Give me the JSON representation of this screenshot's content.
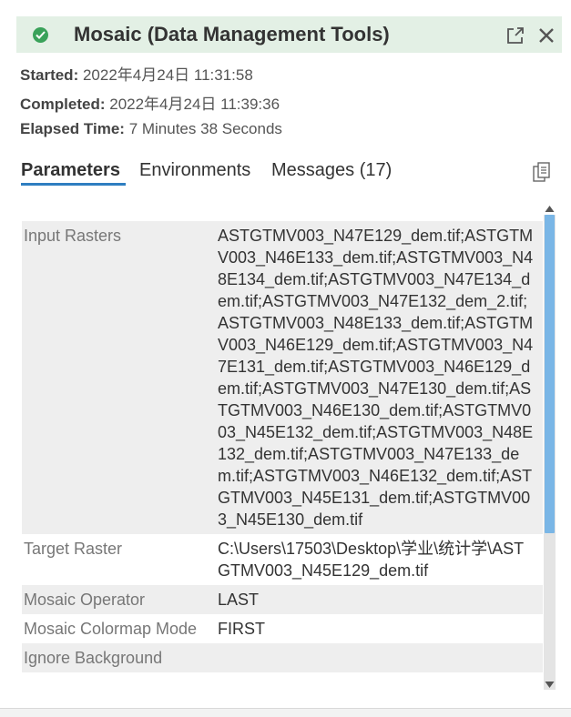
{
  "header": {
    "title": "Mosaic (Data Management Tools)",
    "status_icon": "check-circle-icon",
    "status_color": "#3aa25a",
    "background": "#e3f0e5"
  },
  "meta": {
    "started_label": "Started:",
    "started_value": "2022年4月24日 11:31:58",
    "completed_label": "Completed:",
    "completed_value": "2022年4月24日 11:39:36",
    "elapsed_label": "Elapsed Time:",
    "elapsed_value": "7 Minutes 38 Seconds"
  },
  "tabs": [
    {
      "label": "Parameters",
      "active": true
    },
    {
      "label": "Environments",
      "active": false
    },
    {
      "label": "Messages (17)",
      "active": false
    }
  ],
  "accent_color": "#2f7ec1",
  "parameters": [
    {
      "label": "Input Rasters",
      "value": "ASTGTMV003_N47E129_dem.tif;ASTGTMV003_N46E133_dem.tif;ASTGTMV003_N48E134_dem.tif;ASTGTMV003_N47E134_dem.tif;ASTGTMV003_N47E132_dem_2.tif;ASTGTMV003_N48E133_dem.tif;ASTGTMV003_N46E129_dem.tif;ASTGTMV003_N47E131_dem.tif;ASTGTMV003_N46E129_dem.tif;ASTGTMV003_N47E130_dem.tif;ASTGTMV003_N46E130_dem.tif;ASTGTMV003_N45E132_dem.tif;ASTGTMV003_N48E132_dem.tif;ASTGTMV003_N47E133_dem.tif;ASTGTMV003_N46E132_dem.tif;ASTGTMV003_N45E131_dem.tif;ASTGTMV003_N45E130_dem.tif"
    },
    {
      "label": "Target Raster",
      "value": "C:\\Users\\17503\\Desktop\\学业\\统计学\\ASTGTMV003_N45E129_dem.tif"
    },
    {
      "label": "Mosaic Operator",
      "value": "LAST"
    },
    {
      "label": "Mosaic Colormap Mode",
      "value": "FIRST"
    },
    {
      "label": "Ignore Background",
      "value": ""
    }
  ],
  "icons": {
    "popout": "popout-icon",
    "close": "close-icon",
    "copy": "copy-details-icon"
  }
}
